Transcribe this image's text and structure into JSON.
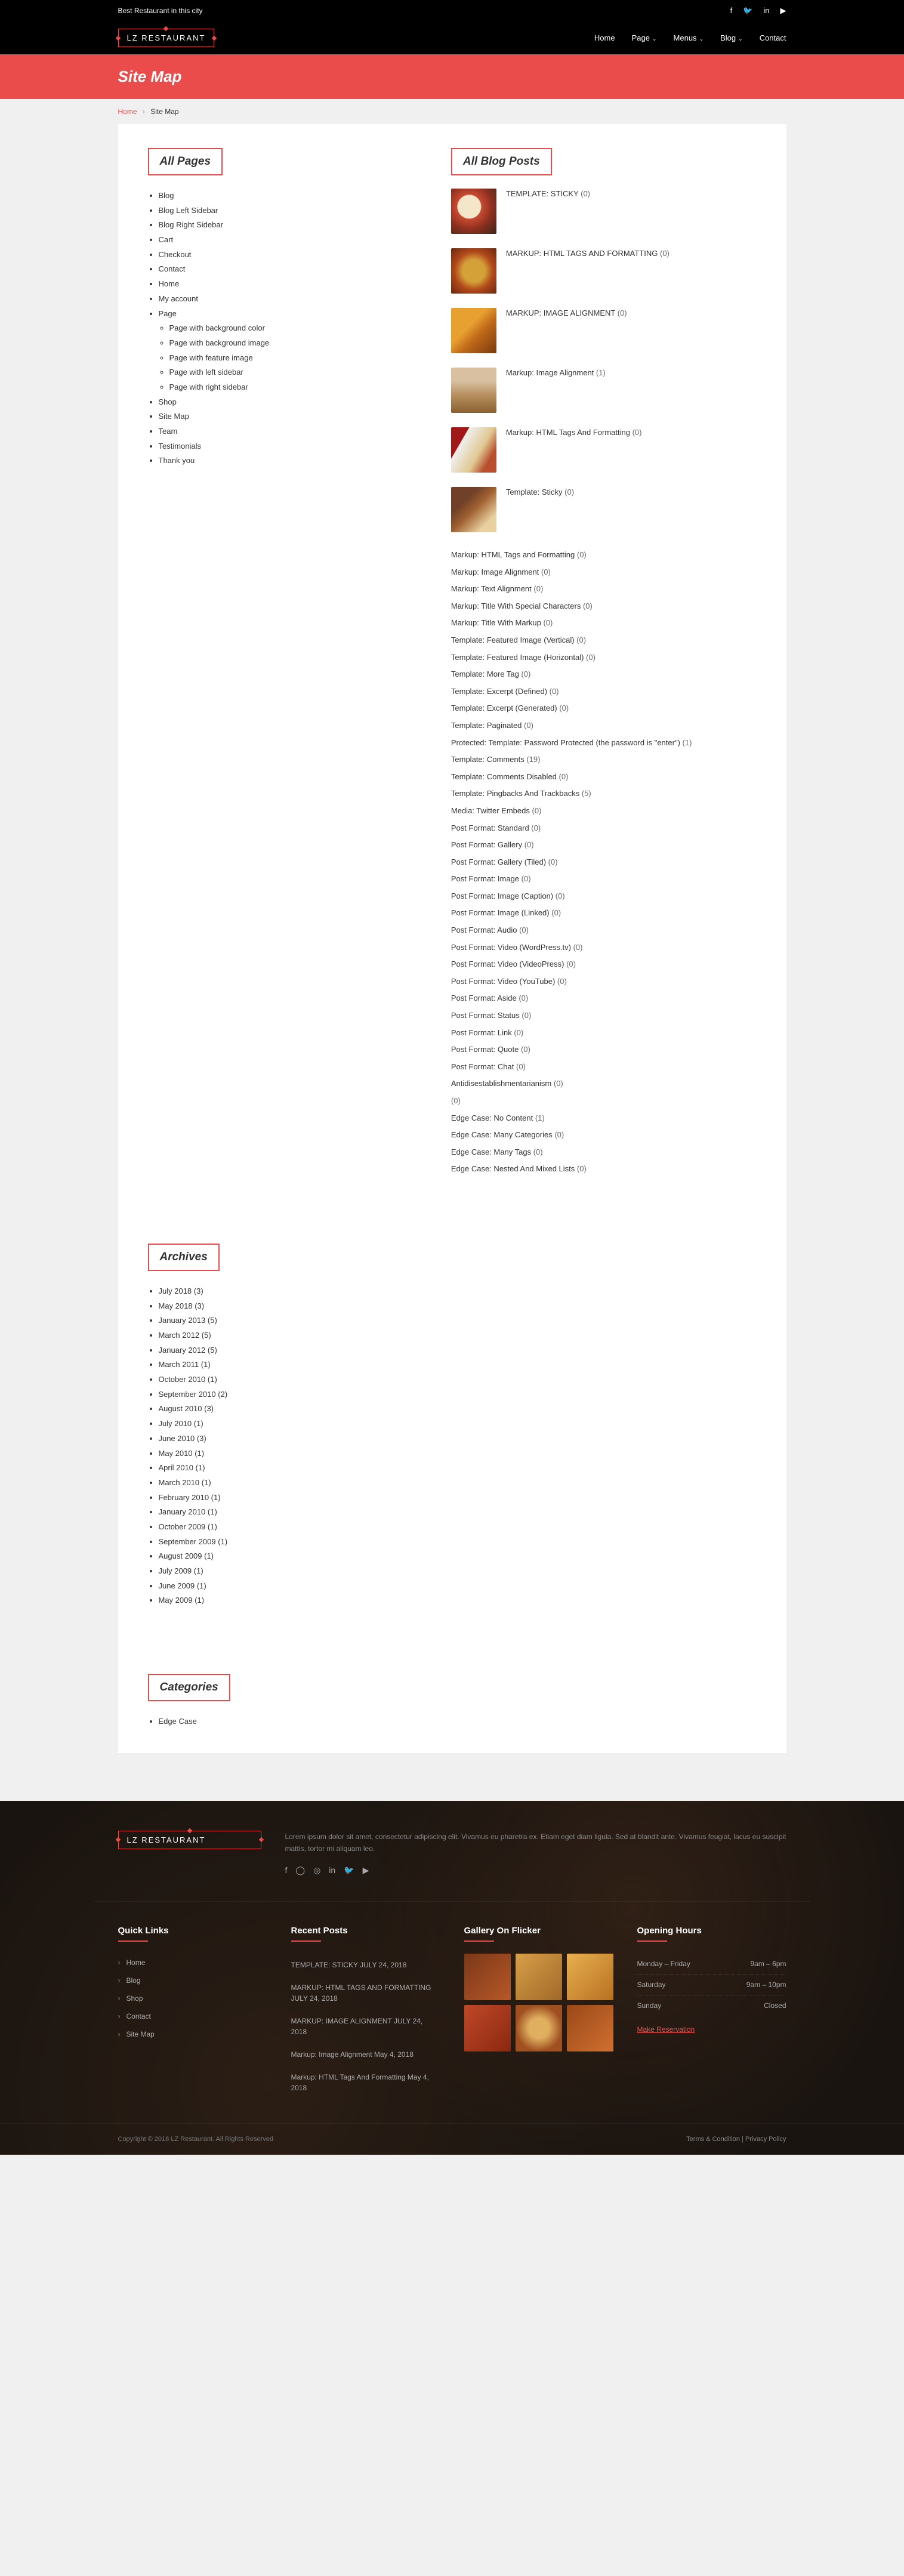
{
  "top": {
    "tagline": "Best Restaurant in this city",
    "logo": "LZ Restaurant"
  },
  "nav": [
    "Home",
    "Page",
    "Menus",
    "Blog",
    "Contact"
  ],
  "banner": {
    "title": "Site Map"
  },
  "crumb": {
    "home": "Home",
    "current": "Site Map"
  },
  "sections": {
    "all_pages": "All Pages",
    "all_blog": "All Blog Posts",
    "archives": "Archives",
    "categories": "Categories"
  },
  "pages": [
    {
      "t": "Blog"
    },
    {
      "t": "Blog Left Sidebar"
    },
    {
      "t": "Blog Right Sidebar"
    },
    {
      "t": "Cart"
    },
    {
      "t": "Checkout"
    },
    {
      "t": "Contact"
    },
    {
      "t": "Home"
    },
    {
      "t": "My account"
    },
    {
      "t": "Page",
      "sub": [
        "Page with background color",
        "Page with background image",
        "Page with feature image",
        "Page with left sidebar",
        "Page with right sidebar"
      ]
    },
    {
      "t": "Shop"
    },
    {
      "t": "Site Map"
    },
    {
      "t": "Team"
    },
    {
      "t": "Testimonials"
    },
    {
      "t": "Thank you"
    }
  ],
  "featured_posts": [
    {
      "title": "TEMPLATE: STICKY",
      "c": "(0)",
      "cls": "p1"
    },
    {
      "title": "MARKUP: HTML TAGS AND FORMATTING",
      "c": "(0)",
      "cls": "p2"
    },
    {
      "title": "MARKUP: IMAGE ALIGNMENT",
      "c": "(0)",
      "cls": "p3"
    },
    {
      "title": "Markup: Image Alignment",
      "c": "(1)",
      "cls": "p4",
      "nocaps": true
    },
    {
      "title": "Markup: HTML Tags And Formatting",
      "c": "(0)",
      "cls": "p5",
      "nocaps": true
    },
    {
      "title": "Template: Sticky",
      "c": "(0)",
      "cls": "p6",
      "nocaps": true
    }
  ],
  "posts": [
    {
      "t": "Markup: HTML Tags and Formatting",
      "c": "(0)"
    },
    {
      "t": "Markup: Image Alignment",
      "c": "(0)"
    },
    {
      "t": "Markup: Text Alignment",
      "c": "(0)"
    },
    {
      "t": "Markup: Title With Special Characters",
      "c": "(0)"
    },
    {
      "t": "Markup: Title With Markup",
      "c": "(0)"
    },
    {
      "t": "Template: Featured Image (Vertical)",
      "c": "(0)"
    },
    {
      "t": "Template: Featured Image (Horizontal)",
      "c": "(0)"
    },
    {
      "t": "Template: More Tag",
      "c": "(0)"
    },
    {
      "t": "Template: Excerpt (Defined)",
      "c": "(0)"
    },
    {
      "t": "Template: Excerpt (Generated)",
      "c": "(0)"
    },
    {
      "t": "Template: Paginated",
      "c": "(0)"
    },
    {
      "t": "Protected: Template: Password Protected (the password is \"enter\")",
      "c": "(1)"
    },
    {
      "t": "Template: Comments",
      "c": "(19)"
    },
    {
      "t": "Template: Comments Disabled",
      "c": "(0)"
    },
    {
      "t": "Template: Pingbacks And Trackbacks",
      "c": "(5)"
    },
    {
      "t": "Media: Twitter Embeds",
      "c": "(0)"
    },
    {
      "t": "Post Format: Standard",
      "c": "(0)"
    },
    {
      "t": "Post Format: Gallery",
      "c": "(0)"
    },
    {
      "t": "Post Format: Gallery (Tiled)",
      "c": "(0)"
    },
    {
      "t": "Post Format: Image",
      "c": "(0)"
    },
    {
      "t": "Post Format: Image (Caption)",
      "c": "(0)"
    },
    {
      "t": "Post Format: Image (Linked)",
      "c": "(0)"
    },
    {
      "t": "Post Format: Audio",
      "c": "(0)"
    },
    {
      "t": "Post Format: Video (WordPress.tv)",
      "c": "(0)"
    },
    {
      "t": "Post Format: Video (VideoPress)",
      "c": "(0)"
    },
    {
      "t": "Post Format: Video (YouTube)",
      "c": "(0)"
    },
    {
      "t": "Post Format: Aside",
      "c": "(0)"
    },
    {
      "t": "Post Format: Status",
      "c": "(0)"
    },
    {
      "t": "Post Format: Link",
      "c": "(0)"
    },
    {
      "t": "Post Format: Quote",
      "c": "(0)"
    },
    {
      "t": "Post Format: Chat",
      "c": "(0)"
    },
    {
      "t": "Antidisestablishmentarianism",
      "c": "(0)"
    },
    {
      "t": "",
      "c": "(0)"
    },
    {
      "t": "Edge Case: No Content",
      "c": "(1)"
    },
    {
      "t": "Edge Case: Many Categories",
      "c": "(0)"
    },
    {
      "t": "Edge Case: Many Tags",
      "c": "(0)"
    },
    {
      "t": "Edge Case: Nested And Mixed Lists",
      "c": "(0)"
    }
  ],
  "archives": [
    {
      "t": "July 2018",
      "c": "(3)"
    },
    {
      "t": "May 2018",
      "c": "(3)"
    },
    {
      "t": "January 2013",
      "c": "(5)"
    },
    {
      "t": "March 2012",
      "c": "(5)"
    },
    {
      "t": "January 2012",
      "c": "(5)"
    },
    {
      "t": "March 2011",
      "c": "(1)"
    },
    {
      "t": "October 2010",
      "c": "(1)"
    },
    {
      "t": "September 2010",
      "c": "(2)"
    },
    {
      "t": "August 2010",
      "c": "(3)"
    },
    {
      "t": "July 2010",
      "c": "(1)"
    },
    {
      "t": "June 2010",
      "c": "(3)"
    },
    {
      "t": "May 2010",
      "c": "(1)"
    },
    {
      "t": "April 2010",
      "c": "(1)"
    },
    {
      "t": "March 2010",
      "c": "(1)"
    },
    {
      "t": "February 2010",
      "c": "(1)"
    },
    {
      "t": "January 2010",
      "c": "(1)"
    },
    {
      "t": "October 2009",
      "c": "(1)"
    },
    {
      "t": "September 2009",
      "c": "(1)"
    },
    {
      "t": "August 2009",
      "c": "(1)"
    },
    {
      "t": "July 2009",
      "c": "(1)"
    },
    {
      "t": "June 2009",
      "c": "(1)"
    },
    {
      "t": "May 2009",
      "c": "(1)"
    }
  ],
  "categories": [
    "Edge Case"
  ],
  "footer": {
    "about": "Lorem ipsum dolor sit amet, consectetur adipiscing elit. Vivamus eu pharetra ex. Etiam eget diam ligula. Sed at blandit ante. Vivamus feugiat, lacus eu suscipit mattis, tortor mi aliquam leo.",
    "quick_title": "Quick Links",
    "quick": [
      "Home",
      "Blog",
      "Shop",
      "Contact",
      "Site Map"
    ],
    "recent_title": "Recent Posts",
    "recent": [
      {
        "t": "TEMPLATE: STICKY July 24, 2018"
      },
      {
        "t": "MARKUP: HTML TAGS AND FORMATTING July 24, 2018"
      },
      {
        "t": "MARKUP: IMAGE ALIGNMENT July 24, 2018"
      },
      {
        "t": "Markup: Image Alignment May 4, 2018",
        "nocaps": true
      },
      {
        "t": "Markup: HTML Tags And Formatting May 4, 2018",
        "nocaps": true
      }
    ],
    "gallery_title": "Gallery On Flicker",
    "hours_title": "Opening Hours",
    "hours": [
      {
        "d": "Monday – Friday",
        "h": "9am – 6pm"
      },
      {
        "d": "Saturday",
        "h": "9am – 10pm"
      },
      {
        "d": "Sunday",
        "h": "Closed"
      }
    ],
    "reserve": "Make Reservation",
    "copyright": "Copyright © 2018 LZ Restaurant. All Rights Reserved",
    "terms": "Terms & Condition",
    "privacy": "Privacy Policy"
  }
}
